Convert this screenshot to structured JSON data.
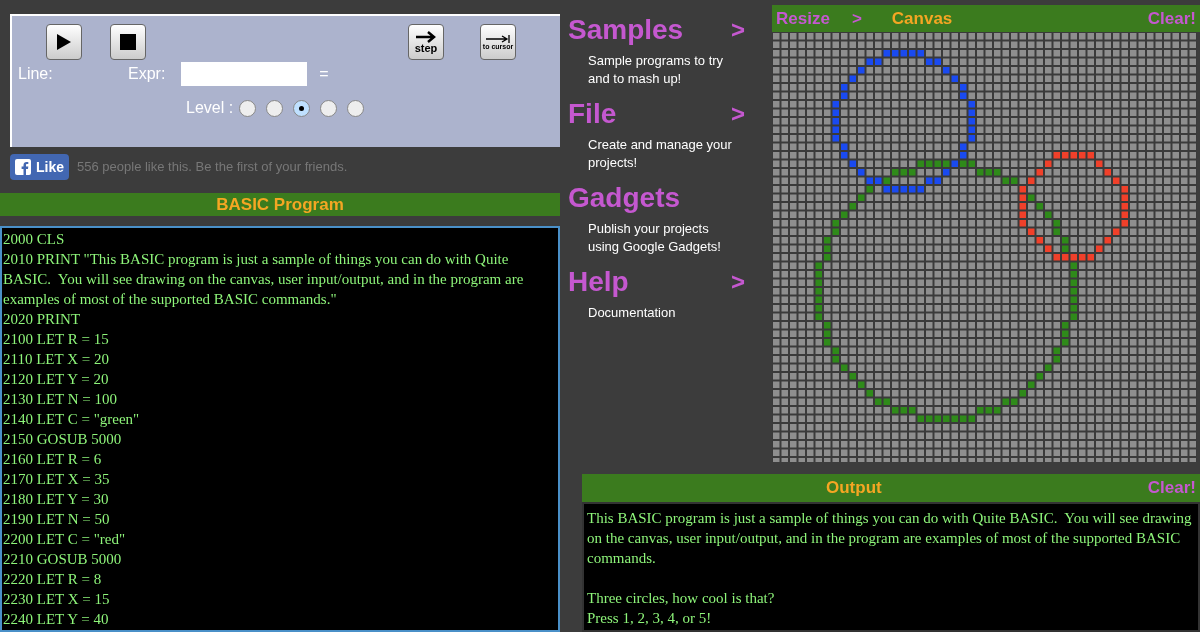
{
  "debugger": {
    "step_label": "step",
    "cursor_label": "to cursor",
    "line_label": "Line:",
    "expr_label": "Expr:",
    "equals": "=",
    "level_label": "Level :",
    "levels": [
      {
        "selected": false
      },
      {
        "selected": false
      },
      {
        "selected": true
      },
      {
        "selected": false
      },
      {
        "selected": false
      }
    ]
  },
  "like": {
    "button": "Like",
    "text": "556 people like this. Be the first of your friends."
  },
  "program": {
    "title": "BASIC Program",
    "lines": [
      "2000 CLS",
      "2010 PRINT \"This BASIC program is just a sample of things you can do with Quite BASIC.  You will see drawing on the canvas, user input/output, and in the program are examples of most of the supported BASIC commands.\"",
      "2020 PRINT",
      "2100 LET R = 15",
      "2110 LET X = 20",
      "2120 LET Y = 20",
      "2130 LET N = 100",
      "2140 LET C = \"green\"",
      "2150 GOSUB 5000",
      "2160 LET R = 6",
      "2170 LET X = 35",
      "2180 LET Y = 30",
      "2190 LET N = 50",
      "2200 LET C = \"red\"",
      "2210 GOSUB 5000",
      "2220 LET R = 8",
      "2230 LET X = 15",
      "2240 LET Y = 40"
    ]
  },
  "menu": [
    {
      "title": "Samples",
      "arrow": ">",
      "text": "Sample programs to try and to mash up!"
    },
    {
      "title": "File",
      "arrow": ">",
      "text": "Create and manage your projects!"
    },
    {
      "title": "Gadgets",
      "text": "Publish your projects using Google Gadgets!"
    },
    {
      "title": "Help",
      "arrow": ">",
      "text": "Documentation"
    }
  ],
  "canvas": {
    "resize": "Resize",
    "arrow": ">",
    "title": "Canvas",
    "clear": "Clear!"
  },
  "output": {
    "title": "Output",
    "clear": "Clear!",
    "paragraphs": [
      [
        "This BASIC program is just a sample of things you can do with Quite BASIC.  You will see drawing on the canvas, user input/output, and in the program are examples of most of the supported BASIC commands."
      ],
      [
        "Three circles, how cool is that?",
        "Press 1, 2, 3, 4, or 5!"
      ]
    ]
  }
}
